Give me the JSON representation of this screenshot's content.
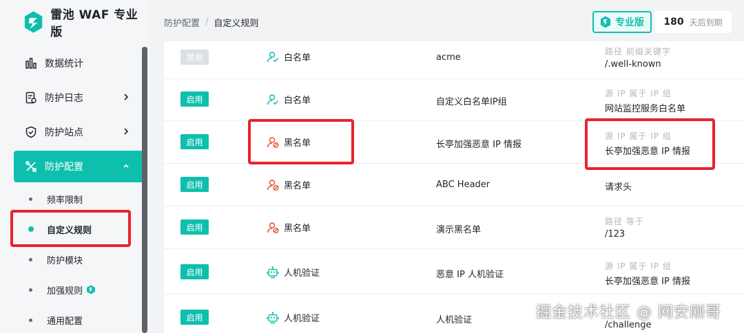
{
  "app": {
    "title": "雷池 WAF 专业版"
  },
  "header": {
    "breadcrumb": [
      "防护配置",
      "自定义规则"
    ],
    "breadcrumb_sep": "/",
    "pro_badge": "专业版",
    "expire_days": "180",
    "expire_label": "天后到期"
  },
  "sidebar": {
    "items": [
      {
        "label": "数据统计",
        "icon": "bar-chart-icon"
      },
      {
        "label": "防护日志",
        "icon": "log-icon"
      },
      {
        "label": "防护站点",
        "icon": "shield-icon"
      },
      {
        "label": "防护配置",
        "icon": "tools-icon"
      }
    ],
    "sub_items": [
      "频率限制",
      "自定义规则",
      "防护模块",
      "加强规则",
      "通用配置"
    ],
    "active_sub": "自定义规则"
  },
  "rules": [
    {
      "status": "禁用",
      "type": "白名单",
      "name": "acme",
      "cond_label": "路径 前缀关键字",
      "cond_value": "/.well-known"
    },
    {
      "status": "启用",
      "type": "白名单",
      "name": "自定义白名单IP组",
      "cond_label": "源 IP 属于 IP 组",
      "cond_value": "网站监控服务白名单"
    },
    {
      "status": "启用",
      "type": "黑名单",
      "name": "长亭加强恶意 IP 情报",
      "cond_label": "源 IP 属于 IP 组",
      "cond_value": "长亭加强恶意 IP 情报"
    },
    {
      "status": "启用",
      "type": "黑名单",
      "name": "ABC Header",
      "cond_label": "",
      "cond_value": "请求头"
    },
    {
      "status": "启用",
      "type": "黑名单",
      "name": "演示黑名单",
      "cond_label": "路径 等于",
      "cond_value": "/123"
    },
    {
      "status": "启用",
      "type": "人机验证",
      "name": "恶意 IP 人机验证",
      "cond_label": "源 IP 属于 IP 组",
      "cond_value": "长亭加强恶意 IP 情报"
    },
    {
      "status": "启用",
      "type": "人机验证",
      "name": "人机验证",
      "cond_label": "",
      "cond_value": "/challenge"
    }
  ],
  "watermark": "掘金技术社区 @ 网安刚哥",
  "colors": {
    "accent": "#0fbfae",
    "whitelist": "#0fbfae",
    "blacklist": "#e8503a",
    "annotation": "#e8232b"
  }
}
